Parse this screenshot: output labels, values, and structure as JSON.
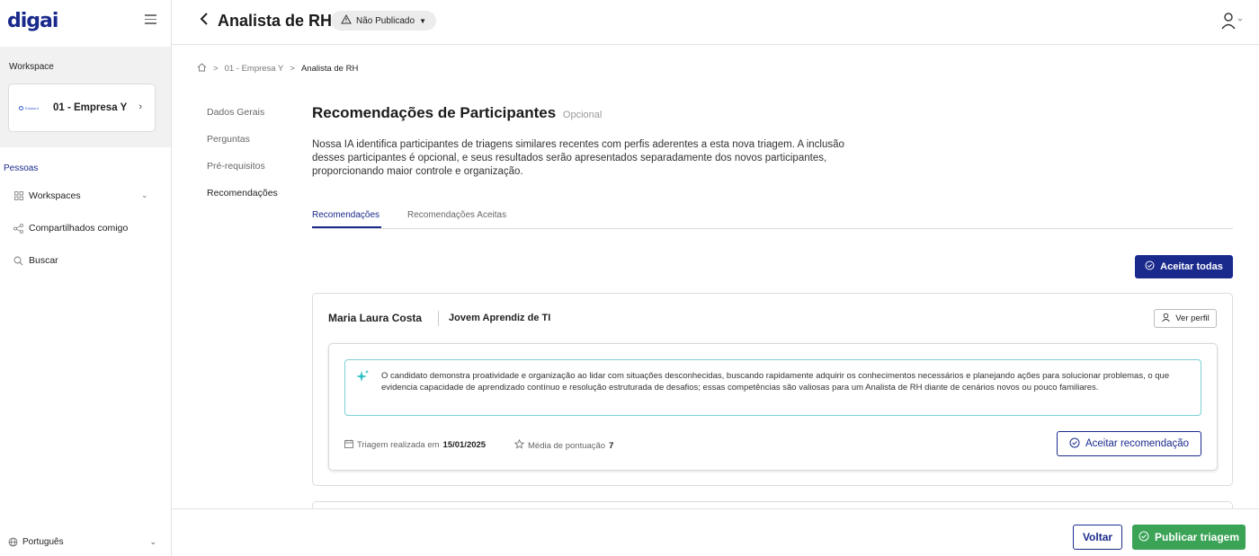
{
  "sidebar": {
    "logo_text": "digai",
    "workspace_title": "Workspace",
    "workspace_name": "01 - Empresa Y",
    "workspace_logo_text": "Edukent",
    "section_label": "Pessoas",
    "items": [
      {
        "label": "Workspaces",
        "icon": "grid-icon"
      },
      {
        "label": "Compartilhados comigo",
        "icon": "share-icon"
      },
      {
        "label": "Buscar",
        "icon": "search-icon"
      }
    ],
    "language": "Português"
  },
  "header": {
    "title": "Analista de RH",
    "status": "Não Publicado"
  },
  "breadcrumb": [
    "01 - Empresa Y",
    "Analista de RH"
  ],
  "subnav": [
    "Dados Gerais",
    "Perguntas",
    "Pré-requisitos",
    "Recomendações"
  ],
  "main": {
    "title": "Recomendações de Participantes",
    "optional": "Opcional",
    "description": "Nossa IA identifica participantes de triagens similares recentes com perfis aderentes a esta nova triagem. A inclusão desses participantes é opcional, e seus resultados serão apresentados separadamente dos novos participantes, proporcionando maior controle e organização.",
    "tabs": [
      "Recomendações",
      "Recomendações Aceitas"
    ],
    "accept_all": "Aceitar todas"
  },
  "candidate": {
    "name": "Maria Laura Costa",
    "role": "Jovem Aprendiz de TI",
    "view_profile": "Ver perfil",
    "ai_text": "O candidato demonstra proatividade e organização ao lidar com situações desconhecidas, buscando rapidamente adquirir os conhecimentos necessários e planejando ações para solucionar problemas, o que evidencia capacidade de aprendizado contínuo e resolução estruturada de desafios; essas competências são valiosas para um Analista de RH diante de cenários novos ou pouco familiares.",
    "triagem_label": "Triagem realizada em",
    "triagem_date": "15/01/2025",
    "score_label": "Média de pontuação",
    "score_value": "7",
    "accept": "Aceitar recomendação"
  },
  "footer": {
    "back": "Voltar",
    "publish": "Publicar triagem"
  },
  "colors": {
    "primary": "#1a2a8c",
    "accent": "#2bbfc4",
    "success": "#3aa356"
  }
}
